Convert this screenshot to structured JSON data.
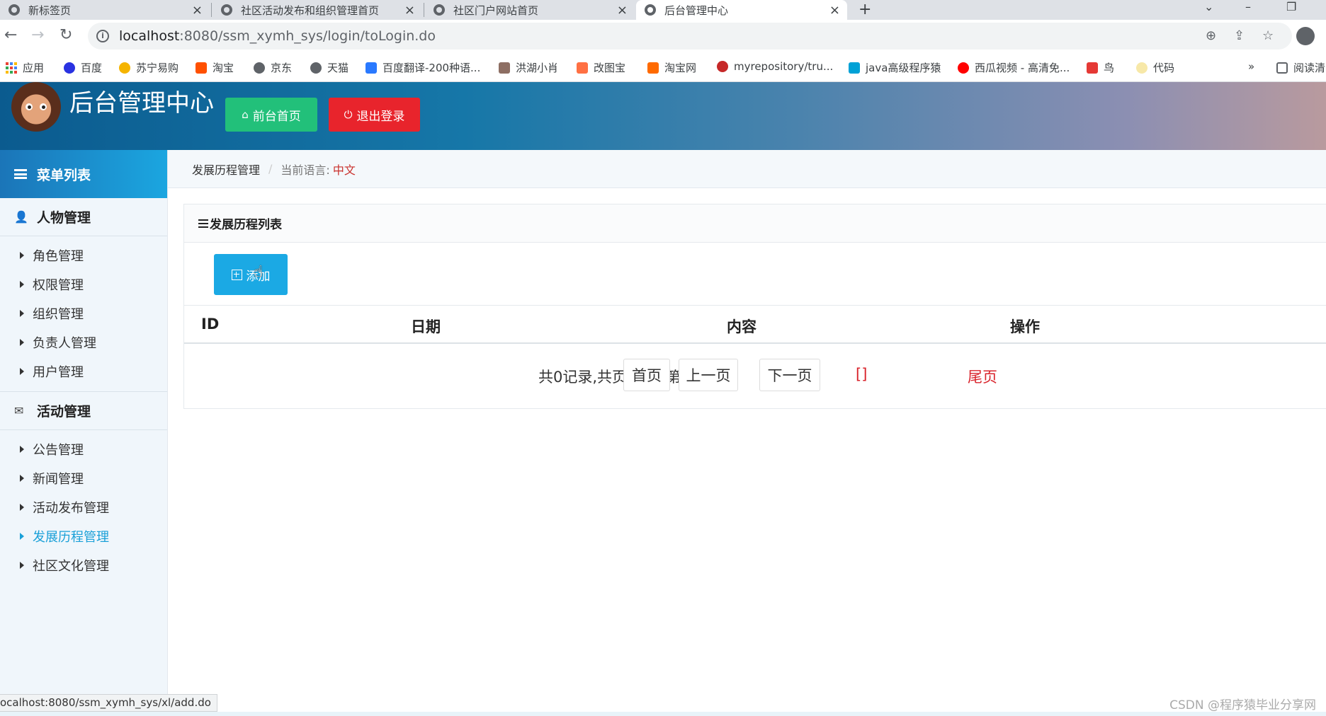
{
  "browser": {
    "tabs": [
      {
        "title": "新标签页",
        "active": false
      },
      {
        "title": "社区活动发布和组织管理首页",
        "active": false
      },
      {
        "title": "社区门户网站首页",
        "active": false
      },
      {
        "title": "后台管理中心",
        "active": true
      }
    ],
    "url_host": "localhost",
    "url_path": ":8080/ssm_xymh_sys/login/toLogin.do",
    "bookmarks": [
      "应用",
      "百度",
      "苏宁易购",
      "淘宝",
      "京东",
      "天猫",
      "百度翻译-200种语...",
      "洪湖小肖",
      "改图宝",
      "淘宝网",
      "myrepository/tru...",
      "java高级程序猿",
      "西瓜视频 - 高清免...",
      "鸟",
      "代码"
    ],
    "bookmarks_overflow": "»",
    "reading_list": "阅读清"
  },
  "header": {
    "title": "后台管理中心",
    "front_button": "前台首页",
    "logout_button": "退出登录"
  },
  "sidebar": {
    "menu_title": "菜单列表",
    "groups": [
      {
        "label": "人物管理",
        "items": [
          "角色管理",
          "权限管理",
          "组织管理",
          "负责人管理",
          "用户管理"
        ]
      },
      {
        "label": "活动管理",
        "items": [
          "公告管理",
          "新闻管理",
          "活动发布管理",
          "发展历程管理",
          "社区文化管理"
        ]
      }
    ],
    "active_item": "发展历程管理"
  },
  "breadcrumb": {
    "current": "发展历程管理",
    "separator": "/",
    "language_label": "当前语言:",
    "language_value": "中文"
  },
  "panel": {
    "title": "发展历程列表",
    "add_button": "添加",
    "columns": [
      "ID",
      "日期",
      "内容",
      "操作"
    ],
    "rows": []
  },
  "pagination": {
    "info": "共0记录,共页, 当前第页",
    "first": "首页",
    "prev": "上一页",
    "current": "[]",
    "next": "下一页",
    "last": "尾页"
  },
  "statusbar": {
    "link": "ocalhost:8080/ssm_xymh_sys/xl/add.do"
  },
  "watermark": "CSDN @程序猿毕业分享网",
  "colors": {
    "accent": "#1ba9e4",
    "green_button": "#22c07a",
    "red_button": "#e8242c",
    "pager_red": "#d9242c",
    "sidebar_bg": "#f0f6fb"
  }
}
